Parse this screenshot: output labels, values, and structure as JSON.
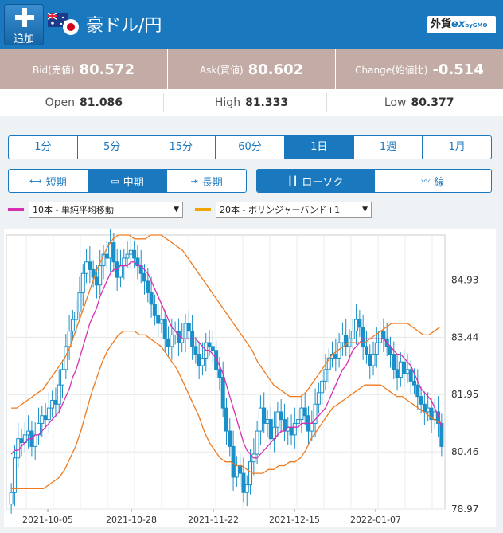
{
  "header": {
    "add_label": "追加",
    "pair_title": "豪ドル/円",
    "logo_main": "外貨",
    "logo_ex": "ex",
    "logo_sub": "byGMO"
  },
  "quotes": {
    "bid": {
      "label": "Bid(売値)",
      "value": "80.572"
    },
    "ask": {
      "label": "Ask(買値)",
      "value": "80.602"
    },
    "change": {
      "label": "Change(始値比)",
      "value": "-0.514"
    }
  },
  "ohl": {
    "open": {
      "label": "Open",
      "value": "81.086"
    },
    "high": {
      "label": "High",
      "value": "81.333"
    },
    "low": {
      "label": "Low",
      "value": "80.377"
    }
  },
  "timeframes": [
    "1分",
    "5分",
    "15分",
    "60分",
    "1日",
    "1週",
    "1月"
  ],
  "active_timeframe": "1日",
  "periods": [
    "短期",
    "中期",
    "長期"
  ],
  "active_period": "中期",
  "chart_types": [
    "ローソク",
    "線"
  ],
  "active_chart_type": "ローソク",
  "indicators": [
    {
      "selected": "10本 - 単純平均移動",
      "color": "#d62fb1"
    },
    {
      "selected": "20本 - ボリンジャーバンド+1",
      "color": "#f0a500"
    }
  ],
  "colors": {
    "accent": "#1a78bf",
    "quote_bg": "#c4aca6",
    "candle": "#1a8fc8",
    "bollinger": "#f07a1e"
  },
  "chart_data": {
    "type": "candlestick",
    "y_ticks": [
      "84.93",
      "83.44",
      "81.95",
      "80.46",
      "78.97"
    ],
    "x_ticks": [
      "2021-10-05",
      "2021-10-28",
      "2021-11-22",
      "2021-12-15",
      "2022-01-07"
    ],
    "ylim": [
      78.97,
      86.1
    ],
    "grid": true,
    "close": [
      79.4,
      80.3,
      80.8,
      80.7,
      80.9,
      81.0,
      80.6,
      80.9,
      81.2,
      81.4,
      81.3,
      81.6,
      81.8,
      81.7,
      82.2,
      82.6,
      83.2,
      83.6,
      83.9,
      84.1,
      84.6,
      85.1,
      85.4,
      85.2,
      85.0,
      84.8,
      85.3,
      85.6,
      85.5,
      85.9,
      85.4,
      85.0,
      85.3,
      85.5,
      85.6,
      85.7,
      85.5,
      85.3,
      85.1,
      84.9,
      84.6,
      84.3,
      84.0,
      83.8,
      83.9,
      83.4,
      83.2,
      83.5,
      83.6,
      83.3,
      83.4,
      83.8,
      83.6,
      83.2,
      83.0,
      82.7,
      82.9,
      83.3,
      83.2,
      83.1,
      82.6,
      82.4,
      81.6,
      81.0,
      80.6,
      79.8,
      80.1,
      79.9,
      79.4,
      79.6,
      80.2,
      80.4,
      81.0,
      81.6,
      81.2,
      81.3,
      80.8,
      81.1,
      81.5,
      81.3,
      81.0,
      81.1,
      80.9,
      81.2,
      81.3,
      81.6,
      81.4,
      81.0,
      81.2,
      81.7,
      82.0,
      82.3,
      82.6,
      82.9,
      83.0,
      82.9,
      83.3,
      83.5,
      83.2,
      83.4,
      83.6,
      83.9,
      83.7,
      83.2,
      83.0,
      82.7,
      83.0,
      83.3,
      83.6,
      83.4,
      83.2,
      83.0,
      82.6,
      82.4,
      82.8,
      82.5,
      82.6,
      82.3,
      82.2,
      81.9,
      81.7,
      81.5,
      81.6,
      81.3,
      81.5,
      81.2,
      80.6
    ],
    "sma10": [
      80.4,
      80.5,
      80.5,
      80.6,
      80.7,
      80.8,
      80.8,
      80.9,
      80.9,
      81.0,
      81.1,
      81.2,
      81.3,
      81.4,
      81.5,
      81.7,
      81.9,
      82.1,
      82.4,
      82.6,
      82.9,
      83.2,
      83.5,
      83.8,
      84.0,
      84.2,
      84.5,
      84.7,
      84.9,
      85.1,
      85.2,
      85.2,
      85.3,
      85.3,
      85.3,
      85.4,
      85.4,
      85.3,
      85.3,
      85.2,
      85.1,
      84.9,
      84.7,
      84.5,
      84.3,
      84.1,
      83.9,
      83.7,
      83.6,
      83.5,
      83.4,
      83.4,
      83.4,
      83.4,
      83.4,
      83.3,
      83.2,
      83.1,
      83.1,
      83.0,
      82.9,
      82.7,
      82.5,
      82.2,
      81.9,
      81.6,
      81.3,
      81.0,
      80.7,
      80.5,
      80.4,
      80.3,
      80.3,
      80.4,
      80.5,
      80.6,
      80.7,
      80.8,
      80.9,
      81.0,
      81.0,
      81.1,
      81.1,
      81.1,
      81.1,
      81.2,
      81.2,
      81.2,
      81.2,
      81.3,
      81.4,
      81.5,
      81.6,
      81.8,
      82.0,
      82.2,
      82.4,
      82.6,
      82.7,
      82.9,
      83.1,
      83.2,
      83.3,
      83.4,
      83.4,
      83.4,
      83.4,
      83.4,
      83.4,
      83.4,
      83.3,
      83.2,
      83.1,
      83.0,
      83.0,
      82.9,
      82.8,
      82.7,
      82.5,
      82.3,
      82.1,
      82.0,
      81.9,
      81.8,
      81.6,
      81.4,
      81.1
    ],
    "bb_upper": [
      81.6,
      81.6,
      81.7,
      81.8,
      81.9,
      82.0,
      82.1,
      82.3,
      82.5,
      82.7,
      82.9,
      83.2,
      83.6,
      84.0,
      84.4,
      84.8,
      85.2,
      85.5,
      85.8,
      86.0,
      86.1,
      86.1,
      86.1,
      86.0,
      86.0,
      86.0,
      86.1,
      86.1,
      86.1,
      86.0,
      85.9,
      85.8,
      85.7,
      85.5,
      85.3,
      85.1,
      84.9,
      84.7,
      84.5,
      84.3,
      84.1,
      83.9,
      83.7,
      83.5,
      83.3,
      83.1,
      82.8,
      82.6,
      82.4,
      82.2,
      82.1,
      82.0,
      81.9,
      81.9,
      81.9,
      82.0,
      82.2,
      82.4,
      82.6,
      82.8,
      83.0,
      83.1,
      83.2,
      83.3,
      83.3,
      83.3,
      83.3,
      83.4,
      83.5,
      83.6,
      83.7,
      83.8,
      83.8,
      83.8,
      83.8,
      83.7,
      83.6,
      83.5,
      83.5,
      83.6,
      83.7
    ],
    "bb_lower": [
      79.5,
      79.5,
      79.5,
      79.5,
      79.5,
      79.5,
      79.5,
      79.6,
      79.7,
      79.8,
      80.0,
      80.3,
      80.6,
      81.0,
      81.5,
      82.0,
      82.4,
      82.8,
      83.1,
      83.3,
      83.5,
      83.6,
      83.6,
      83.6,
      83.5,
      83.5,
      83.4,
      83.3,
      83.2,
      83.0,
      82.8,
      82.6,
      82.3,
      82.0,
      81.7,
      81.4,
      81.0,
      80.7,
      80.5,
      80.3,
      80.2,
      80.2,
      80.1,
      80.1,
      80.0,
      79.9,
      79.9,
      79.9,
      80.0,
      80.0,
      80.1,
      80.1,
      80.2,
      80.2,
      80.3,
      80.5,
      80.8,
      81.0,
      81.2,
      81.4,
      81.6,
      81.7,
      81.8,
      81.9,
      82.0,
      82.1,
      82.2,
      82.2,
      82.2,
      82.2,
      82.1,
      82.0,
      81.9,
      81.9,
      81.8,
      81.7,
      81.6,
      81.5,
      81.4,
      81.3,
      81.2
    ]
  }
}
